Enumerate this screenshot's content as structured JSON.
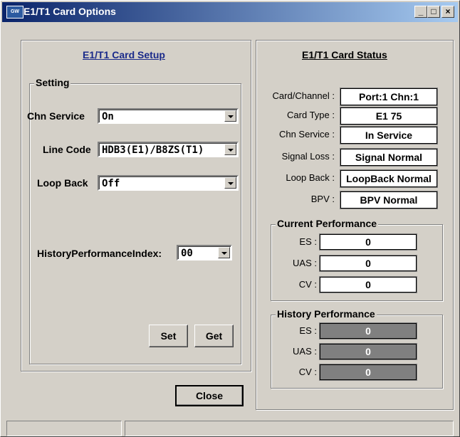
{
  "window": {
    "title": "E1/T1 Card Options",
    "icon_label": "GW"
  },
  "setup": {
    "heading": "E1/T1 Card Setup",
    "group_label": "Setting",
    "chn_service": {
      "label": "Chn Service",
      "value": "On"
    },
    "line_code": {
      "label": "Line Code",
      "value": "HDB3(E1)/B8ZS(T1)"
    },
    "loop_back": {
      "label": "Loop Back",
      "value": "Off"
    },
    "history_index": {
      "label": "HistoryPerformanceIndex:",
      "value": "00"
    },
    "set_label": "Set",
    "get_label": "Get"
  },
  "close_label": "Close",
  "status": {
    "heading": "E1/T1 Card Status",
    "rows": [
      {
        "label": "Card/Channel :",
        "value": "Port:1 Chn:1"
      },
      {
        "label": "Card Type :",
        "value": "E1 75"
      },
      {
        "label": "Chn Service :",
        "value": "In Service"
      },
      {
        "label": "Signal Loss :",
        "value": "Signal Normal"
      },
      {
        "label": "Loop Back :",
        "value": "LoopBack Normal"
      },
      {
        "label": "BPV :",
        "value": "BPV Normal"
      }
    ],
    "current": {
      "label": "Current Performance",
      "rows": [
        {
          "label": "ES :",
          "value": "0"
        },
        {
          "label": "UAS :",
          "value": "0"
        },
        {
          "label": "CV :",
          "value": "0"
        }
      ]
    },
    "history": {
      "label": "History Performance",
      "rows": [
        {
          "label": "ES :",
          "value": "0"
        },
        {
          "label": "UAS :",
          "value": "0"
        },
        {
          "label": "CV :",
          "value": "0"
        }
      ]
    }
  },
  "icons": {
    "minimize": "minimize-icon",
    "maximize": "maximize-icon",
    "close": "close-icon"
  }
}
